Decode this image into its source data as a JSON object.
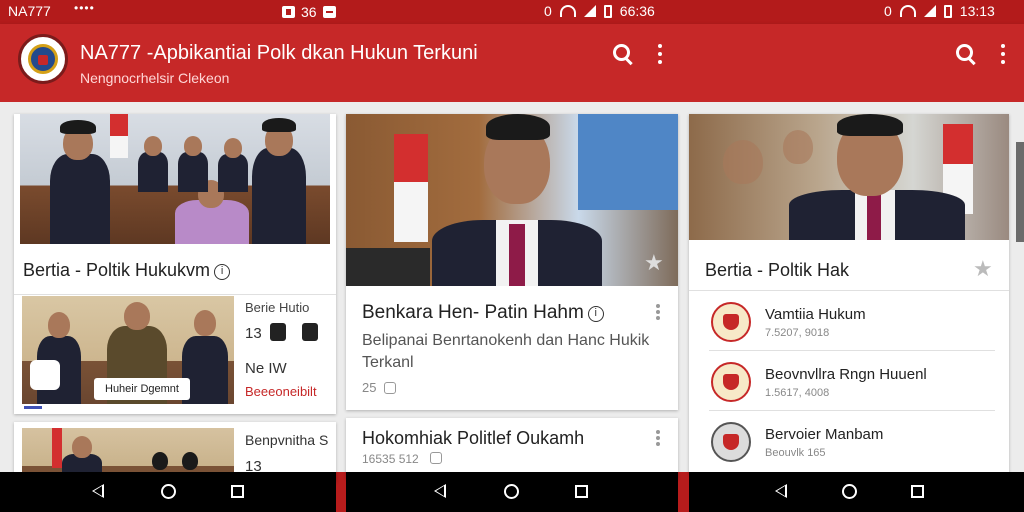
{
  "status_bar": {
    "carrier": "NA777",
    "dots": "••••",
    "mid_text": "36",
    "time_1": "66:36",
    "time_2": "13:13"
  },
  "app_bar": {
    "title": "NA777 -Apbikantiai Polk dkan Hukun Terkuni",
    "subtitle": "Nengnocrhelsir Clekeon"
  },
  "panel_left": {
    "card1_title": "Bertia - Poltik Hukukvm",
    "card2_title": "Berie Hutio",
    "card2_row1": "13",
    "card2_row2_label": "Ne IW",
    "card2_row3": "Beeeoneibilt",
    "card2_caption": "Huheir Dgemnt",
    "card3_title": "Benpvnitha S",
    "card3_row": "13"
  },
  "panel_mid": {
    "card1_title": "Benkara Hen- Patin Hahm",
    "card1_sub": "Belipanai Benrtanokenh dan Hanc Hukik Terkanl",
    "card1_meta": "25",
    "card2_title": "Hokomhiak Politlef Oukamh",
    "card2_meta": "16535 512"
  },
  "panel_right": {
    "card_title": "Bertia - Poltik Hak",
    "items": [
      {
        "title": "Vamtiia Hukum",
        "meta": "7.5207, 9018"
      },
      {
        "title": "Beovnvllra Rngn Huuenl",
        "meta": "1.5617, 4008"
      },
      {
        "title": "Bervoier Manbam",
        "meta": "Beouvlk 165"
      }
    ]
  },
  "colors": {
    "primary": "#c62828",
    "status_bar": "#b31b1b",
    "background": "#ececec"
  }
}
